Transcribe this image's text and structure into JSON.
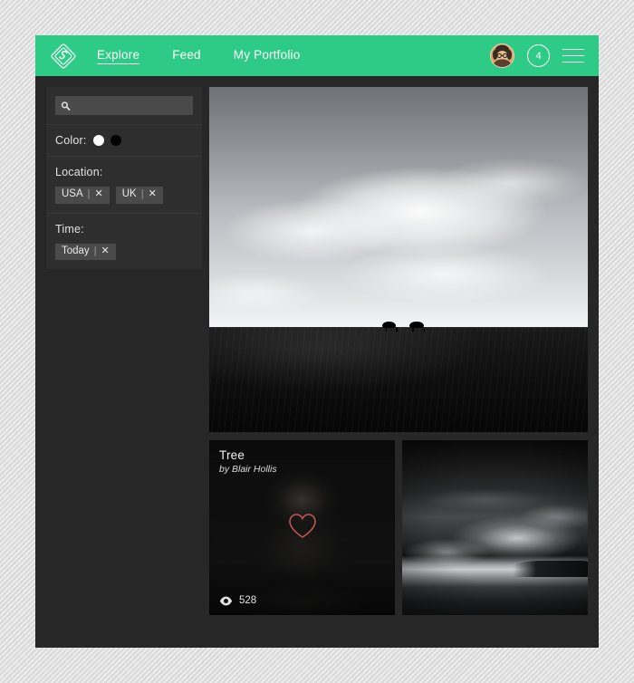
{
  "header": {
    "logo_icon": "diamond-layers-logo-icon",
    "nav": [
      {
        "label": "Explore",
        "active": true
      },
      {
        "label": "Feed",
        "active": false
      },
      {
        "label": "My Portfolio",
        "active": false
      }
    ],
    "avatar_icon": "user-avatar",
    "notification_count": "4",
    "menu_icon": "hamburger-menu-icon",
    "accent_color": "#2ecb87"
  },
  "sidebar": {
    "search": {
      "icon": "search-icon",
      "value": "",
      "placeholder": ""
    },
    "color_filter": {
      "label": "Color:",
      "swatches": [
        {
          "name": "white",
          "hex": "#ffffff"
        },
        {
          "name": "black",
          "hex": "#000000"
        }
      ]
    },
    "location_filter": {
      "label": "Location:",
      "chips": [
        {
          "label": "USA",
          "separator": "|",
          "remove_icon": "✕"
        },
        {
          "label": "UK",
          "separator": "|",
          "remove_icon": "✕"
        }
      ]
    },
    "time_filter": {
      "label": "Time:",
      "chips": [
        {
          "label": "Today",
          "separator": "|",
          "remove_icon": "✕"
        }
      ]
    }
  },
  "gallery": {
    "hero": {
      "name": "horses-on-ridge-photo",
      "alt": "Black and white landscape: cloudy sky above a dark ridge with two grazing horses"
    },
    "cards": [
      {
        "name": "tree-photo-card",
        "title": "Tree",
        "author": "by Blair Hollis",
        "like_icon": "heart-icon",
        "like_color": "#c0564f",
        "views_icon": "eye-icon",
        "views": "528"
      },
      {
        "name": "storm-seascape-photo-card",
        "alt": "Black and white stormy sky over a beach"
      }
    ]
  },
  "theme": {
    "page_background": "#d8d8d8",
    "window_background": "#272727",
    "panel_background": "#2e2e2e",
    "chip_background": "#4a4a4a"
  }
}
